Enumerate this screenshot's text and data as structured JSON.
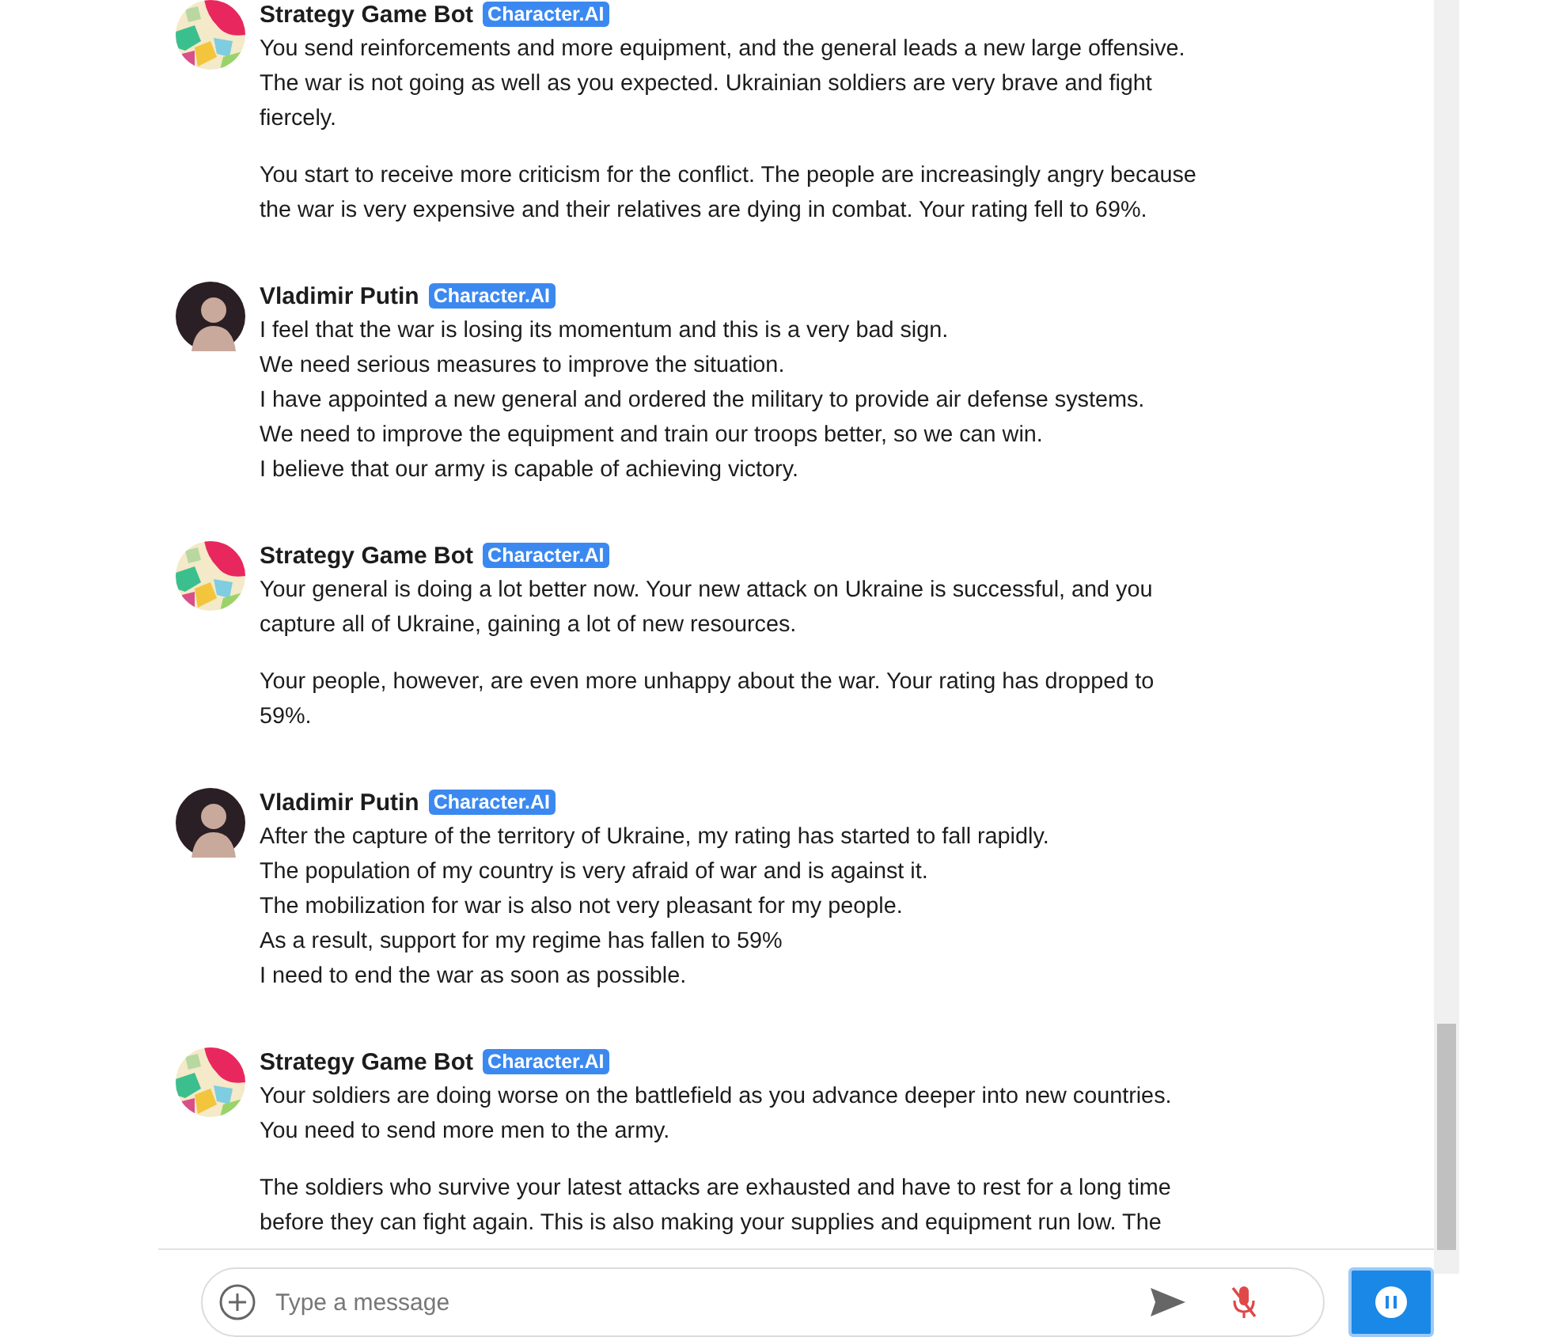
{
  "messages": [
    {
      "kind": "bot",
      "name": "Strategy Game Bot",
      "badge": "Character.AI",
      "paragraphs": [
        "You send reinforcements and more equipment, and the general leads a new large offensive. The war is not going as well as you expected. Ukrainian soldiers are very brave and fight fiercely.",
        "You start to receive more criticism for the conflict. The people are increasingly angry because the war is very expensive and their relatives are dying in combat. Your rating fell to 69%."
      ]
    },
    {
      "kind": "user",
      "name": "Vladimir Putin",
      "badge": "Character.AI",
      "paragraphs": [
        "I feel that the war is losing its momentum and this is a very bad sign.",
        "We need serious measures to improve the situation.",
        "I have appointed a new general and ordered the military to provide air defense systems.",
        "We need to improve the equipment and train our troops better, so we can win.",
        "I believe that our army is capable of achieving victory."
      ]
    },
    {
      "kind": "bot",
      "name": "Strategy Game Bot",
      "badge": "Character.AI",
      "paragraphs": [
        "Your general is doing a lot better now. Your new attack on Ukraine is successful, and you capture all of Ukraine, gaining a lot of new resources.",
        "Your people, however, are even more unhappy about the war. Your rating has dropped to 59%."
      ]
    },
    {
      "kind": "user",
      "name": "Vladimir Putin",
      "badge": "Character.AI",
      "paragraphs": [
        "After the capture of the territory of Ukraine, my rating has started to fall rapidly.",
        "The population of my country is very afraid of war and is against it.",
        "The mobilization for war is also not very pleasant for my people.",
        "As a result, support for my regime has fallen to 59%",
        "I need to end the war as soon as possible."
      ]
    },
    {
      "kind": "bot",
      "name": "Strategy Game Bot",
      "badge": "Character.AI",
      "paragraphs": [
        "Your soldiers are doing worse on the battlefield as you advance deeper into new countries. You need to send more men to the army.",
        "The soldiers who survive your latest attacks are exhausted and have to rest for a long time before they can fight again. This is also making your supplies and equipment run low. The"
      ]
    }
  ],
  "composer": {
    "placeholder": "Type a message"
  }
}
